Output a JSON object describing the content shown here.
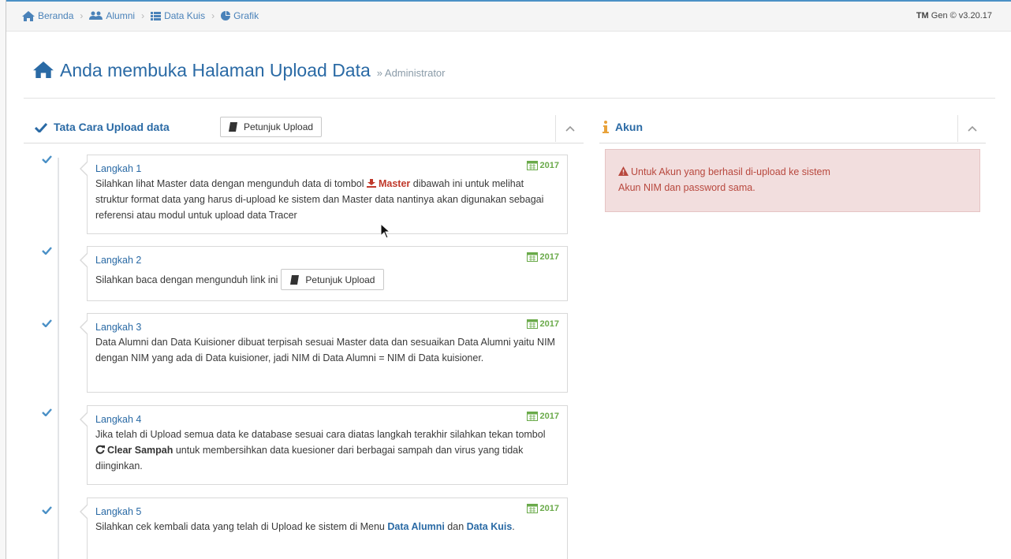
{
  "breadcrumb": {
    "items": [
      {
        "label": "Beranda",
        "icon": "home-icon"
      },
      {
        "label": "Alumni",
        "icon": "users-icon"
      },
      {
        "label": "Data Kuis",
        "icon": "list-icon"
      },
      {
        "label": "Grafik",
        "icon": "pie-chart-icon"
      }
    ]
  },
  "version": {
    "brand": "TM",
    "text": "Gen © v3.20.17"
  },
  "page": {
    "title": "Anda membuka Halaman Upload Data",
    "subtitle": "» Administrator"
  },
  "left_panel": {
    "title": "Tata Cara Upload data",
    "button_label": "Petunjuk Upload",
    "steps": [
      {
        "title": "Langkah 1",
        "date": "2017",
        "text_before": "Silahkan lihat Master data dengan mengunduh data di tombol ",
        "highlight": "Master",
        "text_after": " dibawah ini untuk melihat struktur format data yang harus di-upload ke sistem dan Master data nantinya akan digunakan sebagai referensi atau modul untuk upload data Tracer"
      },
      {
        "title": "Langkah 2",
        "date": "2017",
        "text": "Silahkan baca dengan mengunduh link ini",
        "button_label": "Petunjuk Upload"
      },
      {
        "title": "Langkah 3",
        "date": "2017",
        "text": "Data Alumni dan Data Kuisioner dibuat terpisah sesuai Master data dan sesuaikan Data Alumni yaitu NIM dengan NIM yang ada di Data kuisioner, jadi NIM di Data Alumni = NIM di Data kuisioner."
      },
      {
        "title": "Langkah 4",
        "date": "2017",
        "text_before": "Jika telah di Upload semua data ke database sesuai cara diatas langkah terakhir silahkan tekan tombol ",
        "highlight": "Clear Sampah",
        "text_after": " untuk membersihkan data kuesioner dari berbagai sampah dan virus yang tidak diinginkan."
      },
      {
        "title": "Langkah 5",
        "date": "2017",
        "text_before": "Silahkan cek kembali data yang telah di Upload ke sistem di Menu ",
        "link1": "Data Alumni",
        "text_mid": " dan ",
        "link2": "Data Kuis",
        "text_after": "."
      }
    ]
  },
  "right_panel": {
    "title": "Akun",
    "alert_line1": "Untuk Akun yang berhasil di-upload ke sistem",
    "alert_line2": "Akun NIM dan password sama."
  },
  "colors": {
    "accent": "#2a6aa5",
    "date_green": "#6aaa4a",
    "alert_bg": "#f2dede",
    "alert_text": "#b8483e",
    "info_orange": "#e8a23a"
  }
}
